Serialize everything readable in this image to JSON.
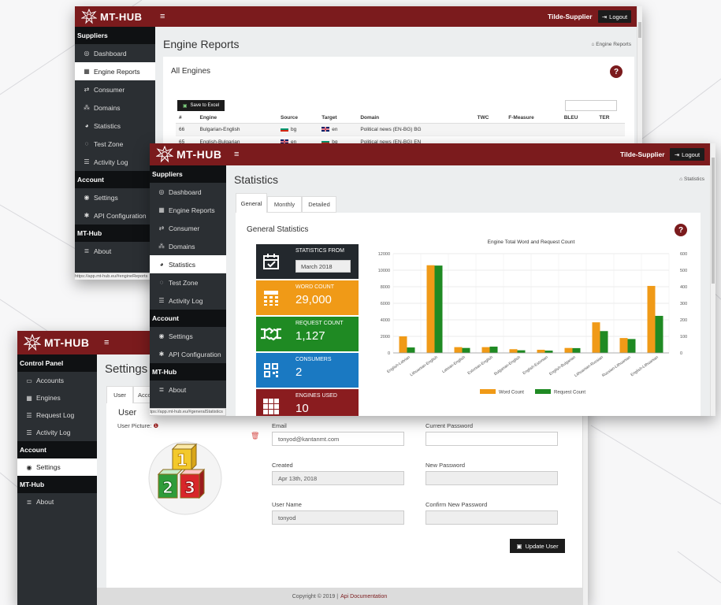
{
  "brand": "MT-HUB",
  "colors": {
    "brand_red": "#7b1b1d",
    "orange": "#f09a17",
    "green": "#1f8a23",
    "blue": "#1a79c2",
    "dark": "#2b2f33",
    "tile_red": "#8a1c1f",
    "tile_dark": "#23282d"
  },
  "back": {
    "user": "Tilde-Supplier",
    "logout": "Logout",
    "menu": [
      {
        "type": "section",
        "label": "Suppliers"
      },
      {
        "type": "item",
        "icon": "dashboard-icon",
        "glyph": "◎",
        "label": "Dashboard"
      },
      {
        "type": "item",
        "icon": "grid-icon",
        "glyph": "▦",
        "label": "Engine Reports",
        "active": true
      },
      {
        "type": "item",
        "icon": "handshake-icon",
        "glyph": "⇄",
        "label": "Consumer"
      },
      {
        "type": "item",
        "icon": "domains-icon",
        "glyph": "⁂",
        "label": "Domains"
      },
      {
        "type": "item",
        "icon": "pie-chart-icon",
        "glyph": "◕",
        "label": "Statistics"
      },
      {
        "type": "item",
        "icon": "test-icon",
        "glyph": "◌",
        "label": "Test Zone"
      },
      {
        "type": "item",
        "icon": "list-icon",
        "glyph": "☰",
        "label": "Activity Log"
      },
      {
        "type": "section",
        "label": "Account"
      },
      {
        "type": "item",
        "icon": "user-icon",
        "glyph": "◉",
        "label": "Settings"
      },
      {
        "type": "item",
        "icon": "gear-icon",
        "glyph": "✱",
        "label": "API Configuration"
      },
      {
        "type": "section",
        "label": "MT-Hub"
      },
      {
        "type": "item",
        "icon": "info-icon",
        "glyph": "≣",
        "label": "About"
      }
    ],
    "page_title": "Engine Reports",
    "breadcrumb": "Engine Reports",
    "panel_title": "All Engines",
    "save_excel": "Save to Excel",
    "table": {
      "headers": [
        "#",
        "Engine",
        "Source",
        "Target",
        "Domain",
        "TWC",
        "F-Measure",
        "BLEU",
        "TER"
      ],
      "rows": [
        {
          "id": "66",
          "engine": "Bulgarian-English",
          "src_flag": "bg",
          "src": "bg",
          "tgt_flag": "en",
          "tgt": "en",
          "domain": "Political news (EN-BG) BG"
        },
        {
          "id": "65",
          "engine": "English-Bulgarian",
          "src_flag": "en",
          "src": "en",
          "tgt_flag": "bg",
          "tgt": "bg",
          "domain": "Political news (EN-BG) EN"
        }
      ]
    },
    "status_url": "https://app.mt-hub.eu/#engineReports"
  },
  "middle": {
    "user": "Tilde-Supplier",
    "logout": "Logout",
    "menu": [
      {
        "type": "section",
        "label": "Suppliers"
      },
      {
        "type": "item",
        "icon": "dashboard-icon",
        "glyph": "◎",
        "label": "Dashboard"
      },
      {
        "type": "item",
        "icon": "grid-icon",
        "glyph": "▦",
        "label": "Engine Reports"
      },
      {
        "type": "item",
        "icon": "handshake-icon",
        "glyph": "⇄",
        "label": "Consumer"
      },
      {
        "type": "item",
        "icon": "domains-icon",
        "glyph": "⁂",
        "label": "Domains"
      },
      {
        "type": "item",
        "icon": "pie-chart-icon",
        "glyph": "◕",
        "label": "Statistics",
        "active": true
      },
      {
        "type": "item",
        "icon": "test-icon",
        "glyph": "◌",
        "label": "Test Zone"
      },
      {
        "type": "item",
        "icon": "list-icon",
        "glyph": "☰",
        "label": "Activity Log"
      },
      {
        "type": "section",
        "label": "Account"
      },
      {
        "type": "item",
        "icon": "user-icon",
        "glyph": "◉",
        "label": "Settings"
      },
      {
        "type": "item",
        "icon": "gear-icon",
        "glyph": "✱",
        "label": "API Configuration"
      },
      {
        "type": "section",
        "label": "MT-Hub"
      },
      {
        "type": "item",
        "icon": "info-icon",
        "glyph": "≣",
        "label": "About"
      }
    ],
    "page_title": "Statistics",
    "breadcrumb": "Statistics",
    "tabs": [
      "General",
      "Monthly",
      "Detailed"
    ],
    "panel_title": "General Statistics",
    "tiles": [
      {
        "icon": "calendar-icon",
        "label": "STATISTICS FROM",
        "value": "March 2018",
        "kind": "input",
        "color": "#23282d"
      },
      {
        "icon": "calculator-icon",
        "label": "WORD COUNT",
        "value": "29,000",
        "color": "#f09a17"
      },
      {
        "icon": "handshake-icon",
        "label": "REQUEST COUNT",
        "value": "1,127",
        "color": "#1f8a23"
      },
      {
        "icon": "qr-icon",
        "label": "CONSUMERS",
        "value": "2",
        "color": "#1a79c2"
      },
      {
        "icon": "apps-icon",
        "label": "ENGINES USED",
        "value": "10",
        "color": "#8a1c1f"
      }
    ],
    "status_url": "https://app.mt-hub.eu/#generalStatistics"
  },
  "chart_data": {
    "type": "bar",
    "title": "Engine Total Word and Request Count",
    "categories": [
      "English-Latvian",
      "Lithuanian-English",
      "Latvian-English",
      "Estonian-English",
      "Bulgarian-English",
      "English-Estonian",
      "English-Bulgarian",
      "Lithuanian-Russian",
      "Russian-Lithuanian",
      "English-Lithuanian"
    ],
    "series": [
      {
        "name": "Word Count",
        "axis": "left",
        "color": "#f09a17",
        "values": [
          2000,
          10600,
          700,
          700,
          450,
          380,
          600,
          3700,
          1800,
          8100
        ]
      },
      {
        "name": "Request Count",
        "axis": "right",
        "color": "#1f8a23",
        "values": [
          33,
          528,
          30,
          38,
          16,
          14,
          29,
          132,
          84,
          224
        ]
      }
    ],
    "ylim_left": [
      0,
      12000
    ],
    "yticks_left": [
      "0",
      "2000",
      "4000",
      "6000",
      "8000",
      "10000",
      "12000"
    ],
    "ylim_right": [
      0,
      600
    ],
    "yticks_right": [
      "0",
      "100",
      "200",
      "300",
      "400",
      "500",
      "600"
    ],
    "grid": true,
    "legend": "bottom"
  },
  "front": {
    "menu": [
      {
        "type": "section",
        "label": "Control Panel"
      },
      {
        "type": "item",
        "icon": "accounts-icon",
        "glyph": "▭",
        "label": "Accounts"
      },
      {
        "type": "item",
        "icon": "engines-icon",
        "glyph": "▦",
        "label": "Engines"
      },
      {
        "type": "item",
        "icon": "list-icon",
        "glyph": "☰",
        "label": "Request Log"
      },
      {
        "type": "item",
        "icon": "list-icon",
        "glyph": "☰",
        "label": "Activity Log"
      },
      {
        "type": "section",
        "label": "Account"
      },
      {
        "type": "item",
        "icon": "user-icon",
        "glyph": "◉",
        "label": "Settings",
        "active": true
      },
      {
        "type": "section",
        "label": "MT-Hub"
      },
      {
        "type": "item",
        "icon": "info-icon",
        "glyph": "≣",
        "label": "About"
      }
    ],
    "page_title": "Settings",
    "tabs": [
      "User",
      "Accou"
    ],
    "section_title": "User",
    "user_picture_label": "User Picture:",
    "fields": {
      "email_label": "Email",
      "email": "tonyod@kantanmt.com",
      "current_password_label": "Current Password",
      "created_label": "Created",
      "created": "Apr 13th, 2018",
      "new_password_label": "New Password",
      "username_label": "User Name",
      "username": "tonyod",
      "confirm_password_label": "Confirm New Password"
    },
    "update_button": "Update User",
    "footer_text": "Copyright © 2019 |",
    "footer_link": "Api Documentation"
  }
}
